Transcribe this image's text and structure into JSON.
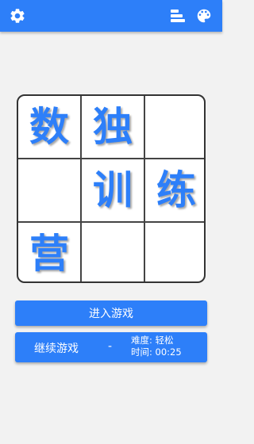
{
  "topbar": {
    "color": "#2d7ff9",
    "left_icons": [
      "gear-icon"
    ],
    "right_icons": [
      "stats-icon",
      "palette-icon"
    ]
  },
  "board": {
    "cells": [
      [
        "数",
        "独",
        ""
      ],
      [
        "",
        "训",
        "练"
      ],
      [
        "营",
        "",
        ""
      ]
    ]
  },
  "buttons": {
    "start_label": "进入游戏",
    "continue_label": "继续游戏",
    "continue_separator": "-",
    "difficulty": "难度: 轻松",
    "time": "时间: 00:25"
  }
}
